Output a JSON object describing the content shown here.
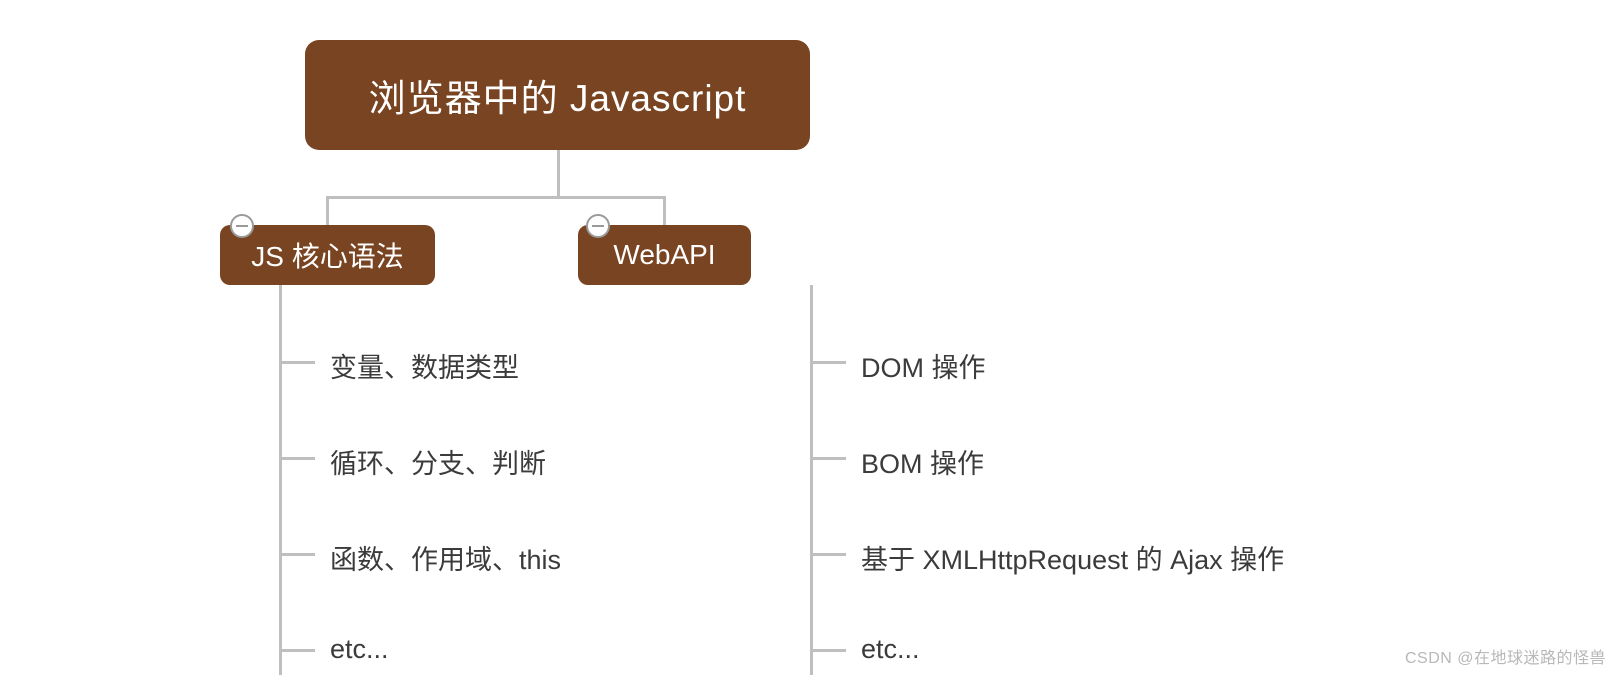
{
  "root": {
    "label": "浏览器中的 Javascript"
  },
  "children": [
    {
      "label": "JS 核心语法",
      "items": [
        "变量、数据类型",
        "循环、分支、判断",
        "函数、作用域、this",
        "etc..."
      ]
    },
    {
      "label": "WebAPI",
      "items": [
        "DOM 操作",
        "BOM 操作",
        "基于 XMLHttpRequest 的 Ajax 操作",
        "etc..."
      ]
    }
  ],
  "watermark": "CSDN @在地球迷路的怪兽",
  "colors": {
    "node": "#784421",
    "text": "#3b3b3b",
    "line": "#bfbfbf"
  }
}
